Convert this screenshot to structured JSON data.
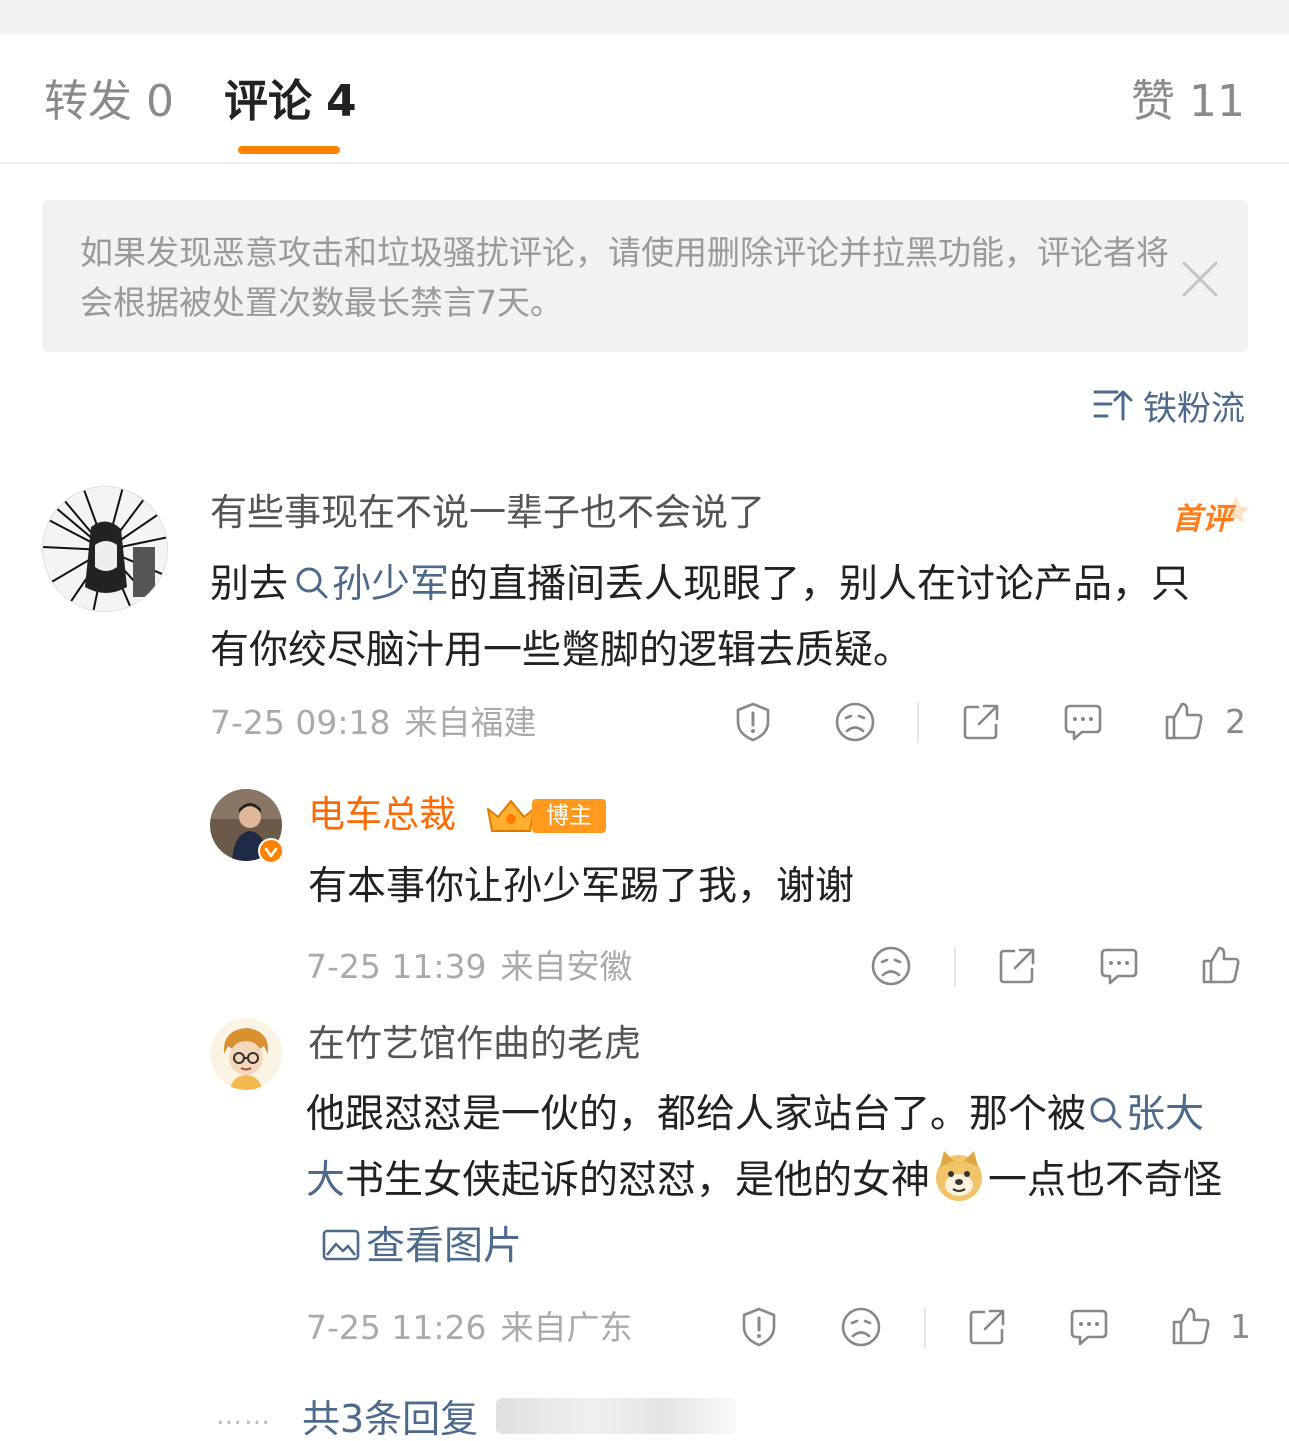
{
  "tabs": [
    {
      "label": "转发",
      "count": "0"
    },
    {
      "label": "评论",
      "count": "4"
    },
    {
      "label": "赞",
      "count": "11"
    }
  ],
  "notice": {
    "text": "如果发现恶意攻击和垃圾骚扰评论，请使用删除评论并拉黑功能，评论者将会根据被处置次数最长禁言7天。"
  },
  "sort": {
    "label": "铁粉流"
  },
  "comments": [
    {
      "nickname": "有些事现在不说一辈子也不会说了",
      "badge": "首评",
      "text_before": "别去",
      "link": "孙少军",
      "text_after": "的直播间丢人现眼了，别人在讨论产品，只有你绞尽脑汁用一些蹩脚的逻辑去质疑。",
      "time": "7-25 09:18",
      "location": "来自福建",
      "likes": "2"
    },
    {
      "nickname": "电车总裁",
      "badge": "博主",
      "text": "有本事你让孙少军踢了我，谢谢",
      "time": "7-25 11:39",
      "location": "来自安徽"
    },
    {
      "nickname": "在竹艺馆作曲的老虎",
      "text_before": "他跟怼怼是一伙的，都给人家站台了。那个被",
      "link": "张大大",
      "text_mid": "书生女侠起诉的怼怼，是他的女神",
      "text_after": "一点也不奇怪",
      "image_link": "查看图片",
      "time": "7-25 11:26",
      "location": "来自广东",
      "likes": "1"
    }
  ],
  "more_replies": {
    "dots": "……",
    "label": "共3条回复"
  },
  "colors": {
    "accent": "#ff8200",
    "link": "#4c6a8c",
    "blogger": "#ff6a00"
  }
}
